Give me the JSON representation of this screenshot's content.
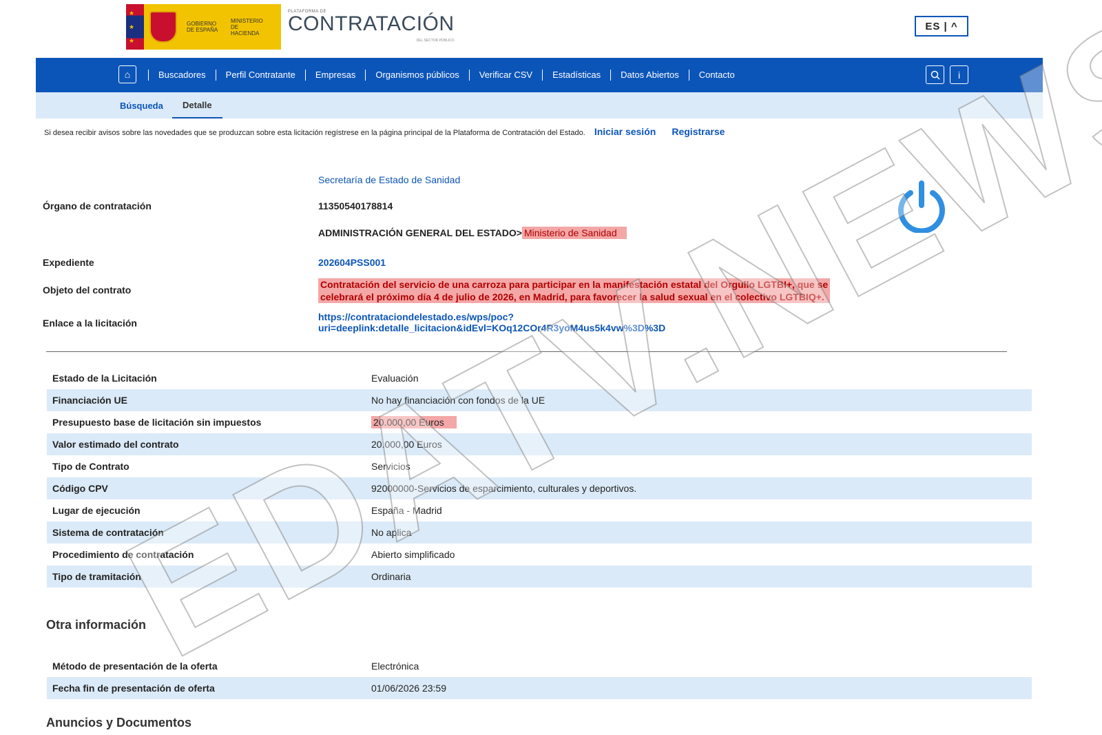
{
  "header": {
    "gov_text": "GOBIERNO DE ESPAÑA",
    "ministry_text": "MINISTERIO DE HACIENDA",
    "brand_pre": "PLATAFORMA DE",
    "brand_main": "CONTRATACIÓN",
    "brand_sub": "DEL SECTOR PÚBLICO",
    "lang_label": "ES | ^"
  },
  "nav": {
    "items": [
      "Buscadores",
      "Perfil Contratante",
      "Empresas",
      "Organismos públicos",
      "Verificar CSV",
      "Estadísticas",
      "Datos Abiertos",
      "Contacto"
    ],
    "home_icon": "home-icon",
    "search_icon": "search-icon",
    "info_icon": "info-icon"
  },
  "subnav": {
    "tab1": "Búsqueda",
    "tab2": "Detalle"
  },
  "notice": {
    "text": "Si desea recibir avisos sobre las novedades que se produzcan sobre esta licitación regístrese en la página principal de la Plataforma de Contratación del Estado.",
    "login": "Iniciar sesión",
    "register": "Registrarse"
  },
  "organ": {
    "label": "Órgano de contratación",
    "name": "Secretaría de Estado de Sanidad",
    "code": "11350540178814",
    "path_prefix": "ADMINISTRACIÓN GENERAL DEL ESTADO>",
    "path_highlight": "Ministerio de Sanidad"
  },
  "expediente": {
    "label": "Expediente",
    "value": "202604PSS001"
  },
  "objeto": {
    "label": "Objeto del contrato",
    "line1": "Contratación del servicio de una carroza para participar en la manifestación estatal del Orgullo LGTBI+, que se",
    "line2": "celebrará el próximo día 4 de julio de 2026, en Madrid, para favorecer la salud sexual en el colectivo LGTBIQ+."
  },
  "enlace": {
    "label": "Enlace a la licitación",
    "line1": "https://contrataciondelestado.es/wps/poc?",
    "line2": "uri=deeplink:detalle_licitacion&idEvl=KOq12COr4R3yoM4us5k4vw%3D%3D"
  },
  "details": [
    {
      "k": "Estado de la Licitación",
      "v": "Evaluación"
    },
    {
      "k": "Financiación UE",
      "v": "No hay financiación con fondos de la UE"
    },
    {
      "k": "Presupuesto base de licitación sin impuestos",
      "v": "20.000,00 Euros"
    },
    {
      "k": "Valor estimado del contrato",
      "v": "20.000,00 Euros"
    },
    {
      "k": "Tipo de Contrato",
      "v": "Servicios"
    },
    {
      "k": "Código CPV",
      "v": "92000000-Servicios de esparcimiento, culturales y deportivos."
    },
    {
      "k": "Lugar de ejecución",
      "v": "España - Madrid"
    },
    {
      "k": "Sistema de contratación",
      "v": "No aplica"
    },
    {
      "k": "Procedimiento de contratación",
      "v": "Abierto simplificado"
    },
    {
      "k": "Tipo de tramitación",
      "v": "Ordinaria"
    }
  ],
  "otra": {
    "title": "Otra información",
    "rows": [
      {
        "k": "Método de presentación de la oferta",
        "v": "Electrónica"
      },
      {
        "k": "Fecha fin de presentación de oferta",
        "v": "01/06/2026 23:59"
      }
    ]
  },
  "anuncios": {
    "title": "Anuncios y Documentos"
  },
  "watermark": "EDATV.NEWS",
  "colors": {
    "primary": "#0c55b8",
    "light": "#dbeaf8",
    "highlight": "#f4a7a7",
    "power": "#2f8fe0"
  }
}
